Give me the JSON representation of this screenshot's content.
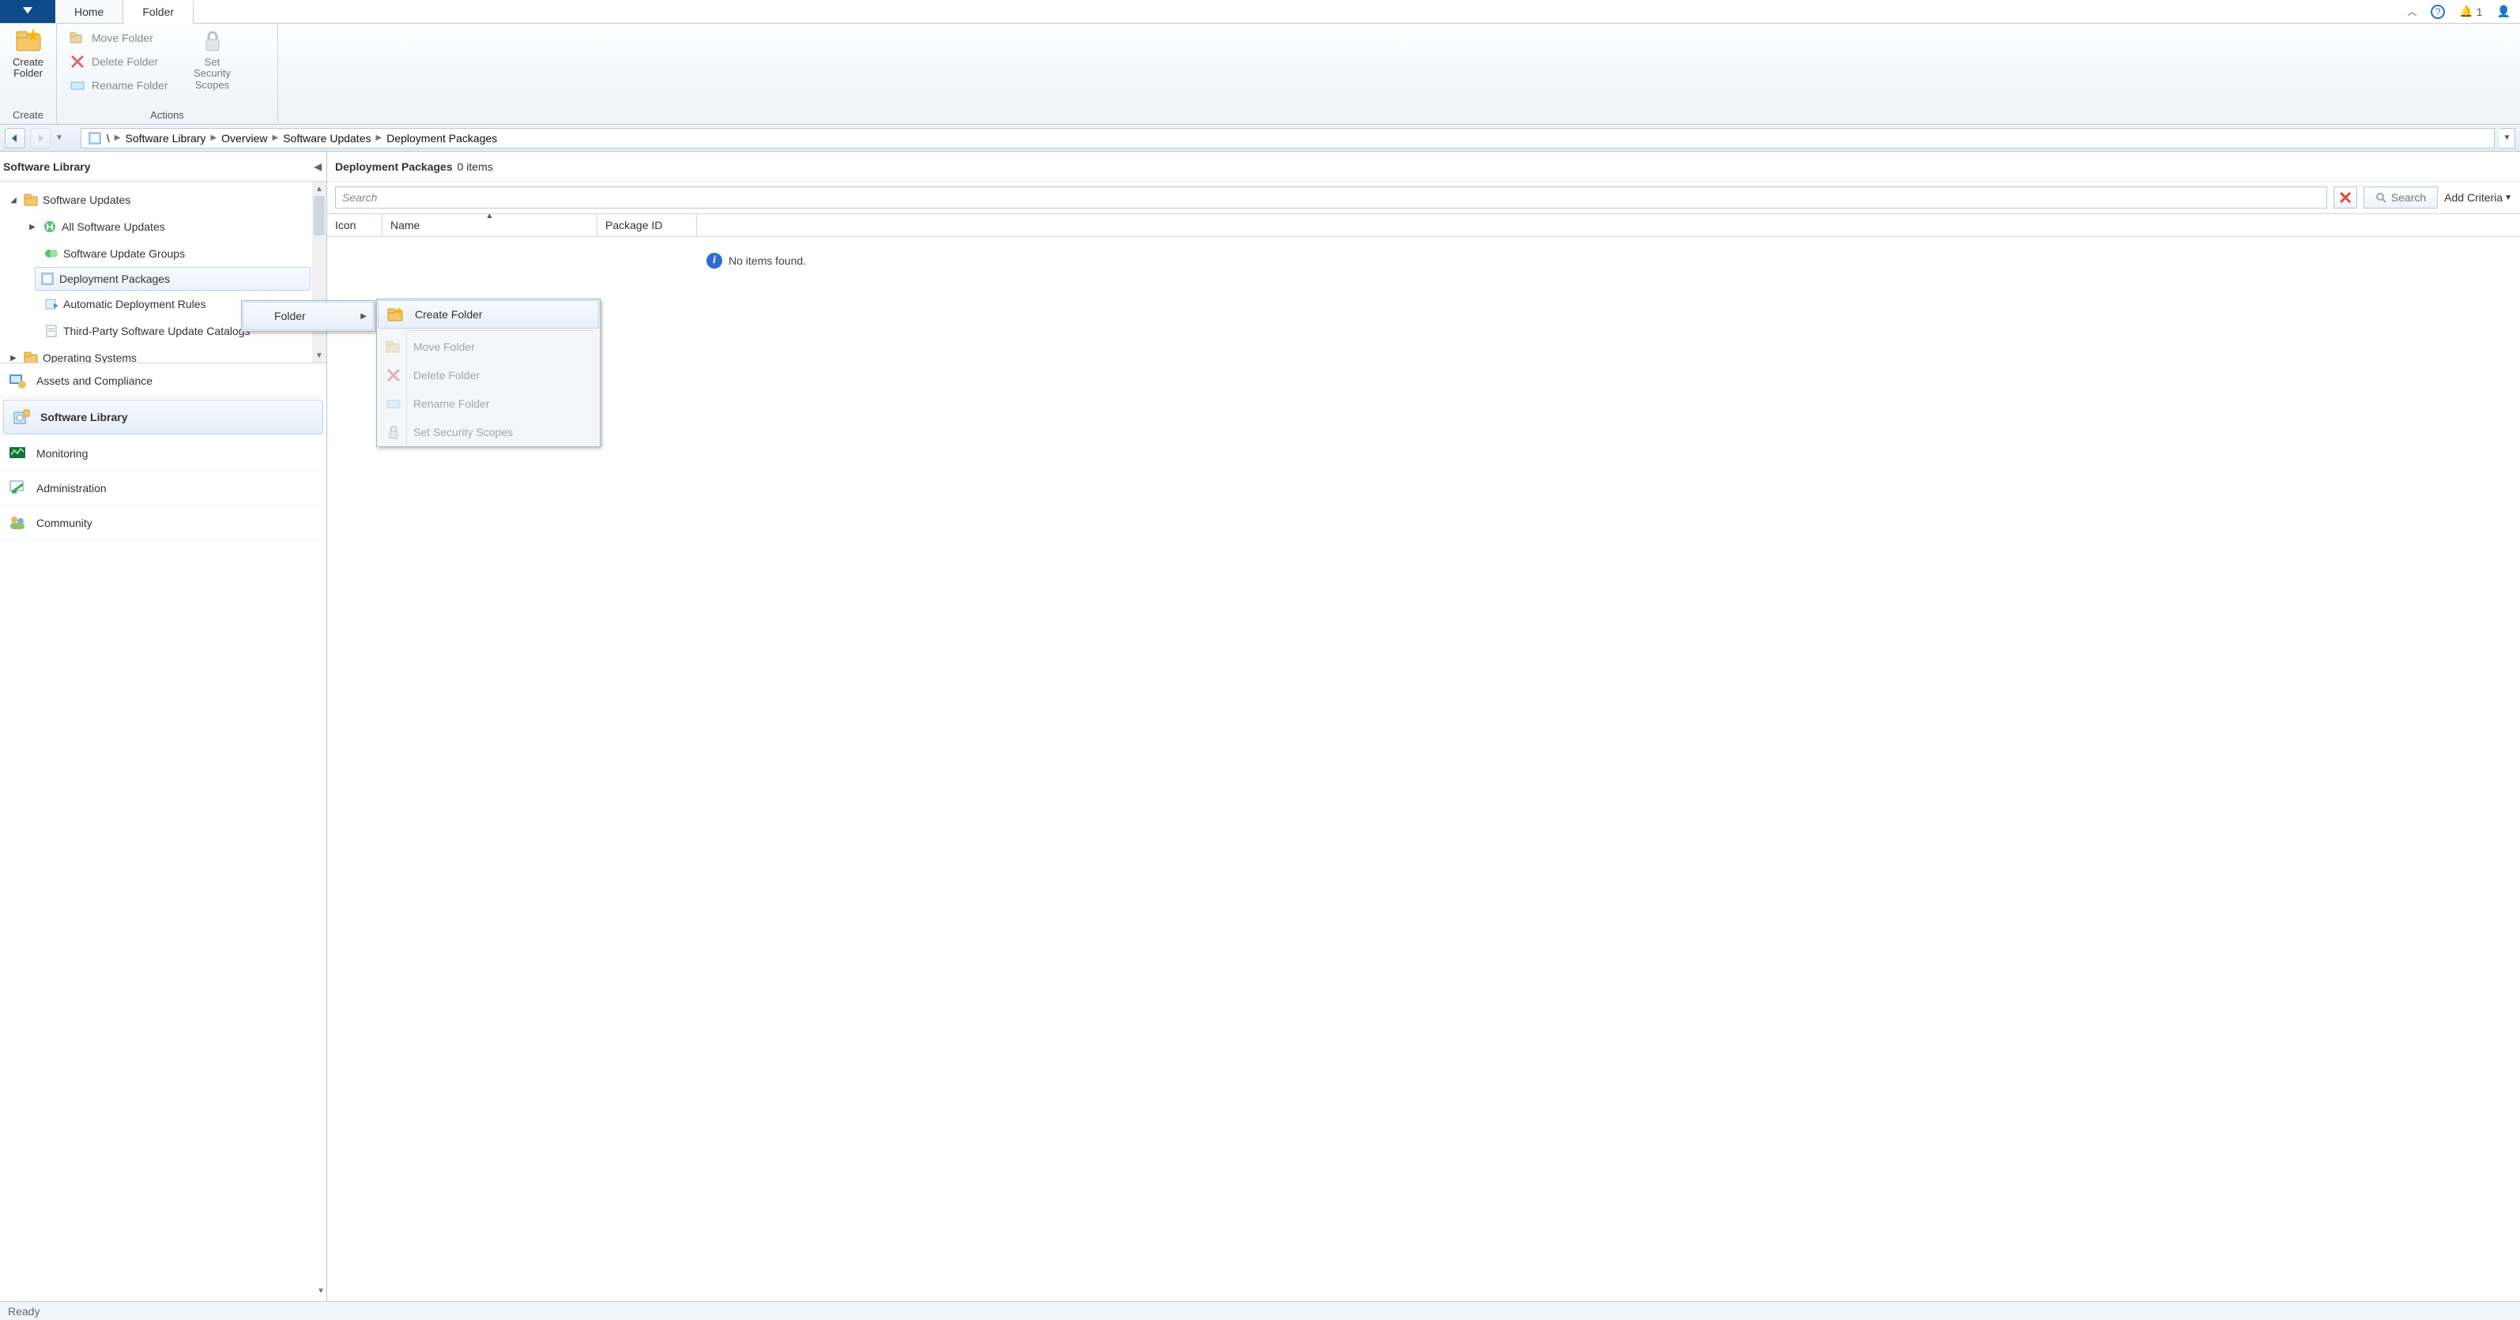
{
  "tabs": {
    "home": "Home",
    "folder": "Folder"
  },
  "titlebar": {
    "notif_count": "1"
  },
  "ribbon": {
    "create_folder": "Create\nFolder",
    "create_group": "Create",
    "move": "Move Folder",
    "delete": "Delete Folder",
    "rename": "Rename Folder",
    "scopes": "Set Security\nScopes",
    "actions_group": "Actions"
  },
  "breadcrumb": {
    "root": "\\",
    "items": [
      "Software Library",
      "Overview",
      "Software Updates",
      "Deployment Packages"
    ]
  },
  "sidebar": {
    "title": "Software Library",
    "tree": {
      "software_updates": "Software Updates",
      "all": "All Software Updates",
      "groups": "Software Update Groups",
      "deploy_pkgs": "Deployment Packages",
      "adr": "Automatic Deployment Rules",
      "catalogs": "Third-Party Software Update Catalogs",
      "os": "Operating Systems"
    },
    "wunderbar": {
      "assets": "Assets and Compliance",
      "library": "Software Library",
      "monitoring": "Monitoring",
      "admin": "Administration",
      "community": "Community"
    }
  },
  "content": {
    "title": "Deployment Packages",
    "count": "0 items",
    "search_placeholder": "Search",
    "search_btn": "Search",
    "add_criteria": "Add Criteria",
    "columns": {
      "icon": "Icon",
      "name": "Name",
      "pkgid": "Package ID"
    },
    "no_items": "No items found."
  },
  "context": {
    "folder": "Folder",
    "create": "Create Folder",
    "move": "Move Folder",
    "delete": "Delete Folder",
    "rename": "Rename Folder",
    "scopes": "Set Security Scopes"
  },
  "status": "Ready"
}
